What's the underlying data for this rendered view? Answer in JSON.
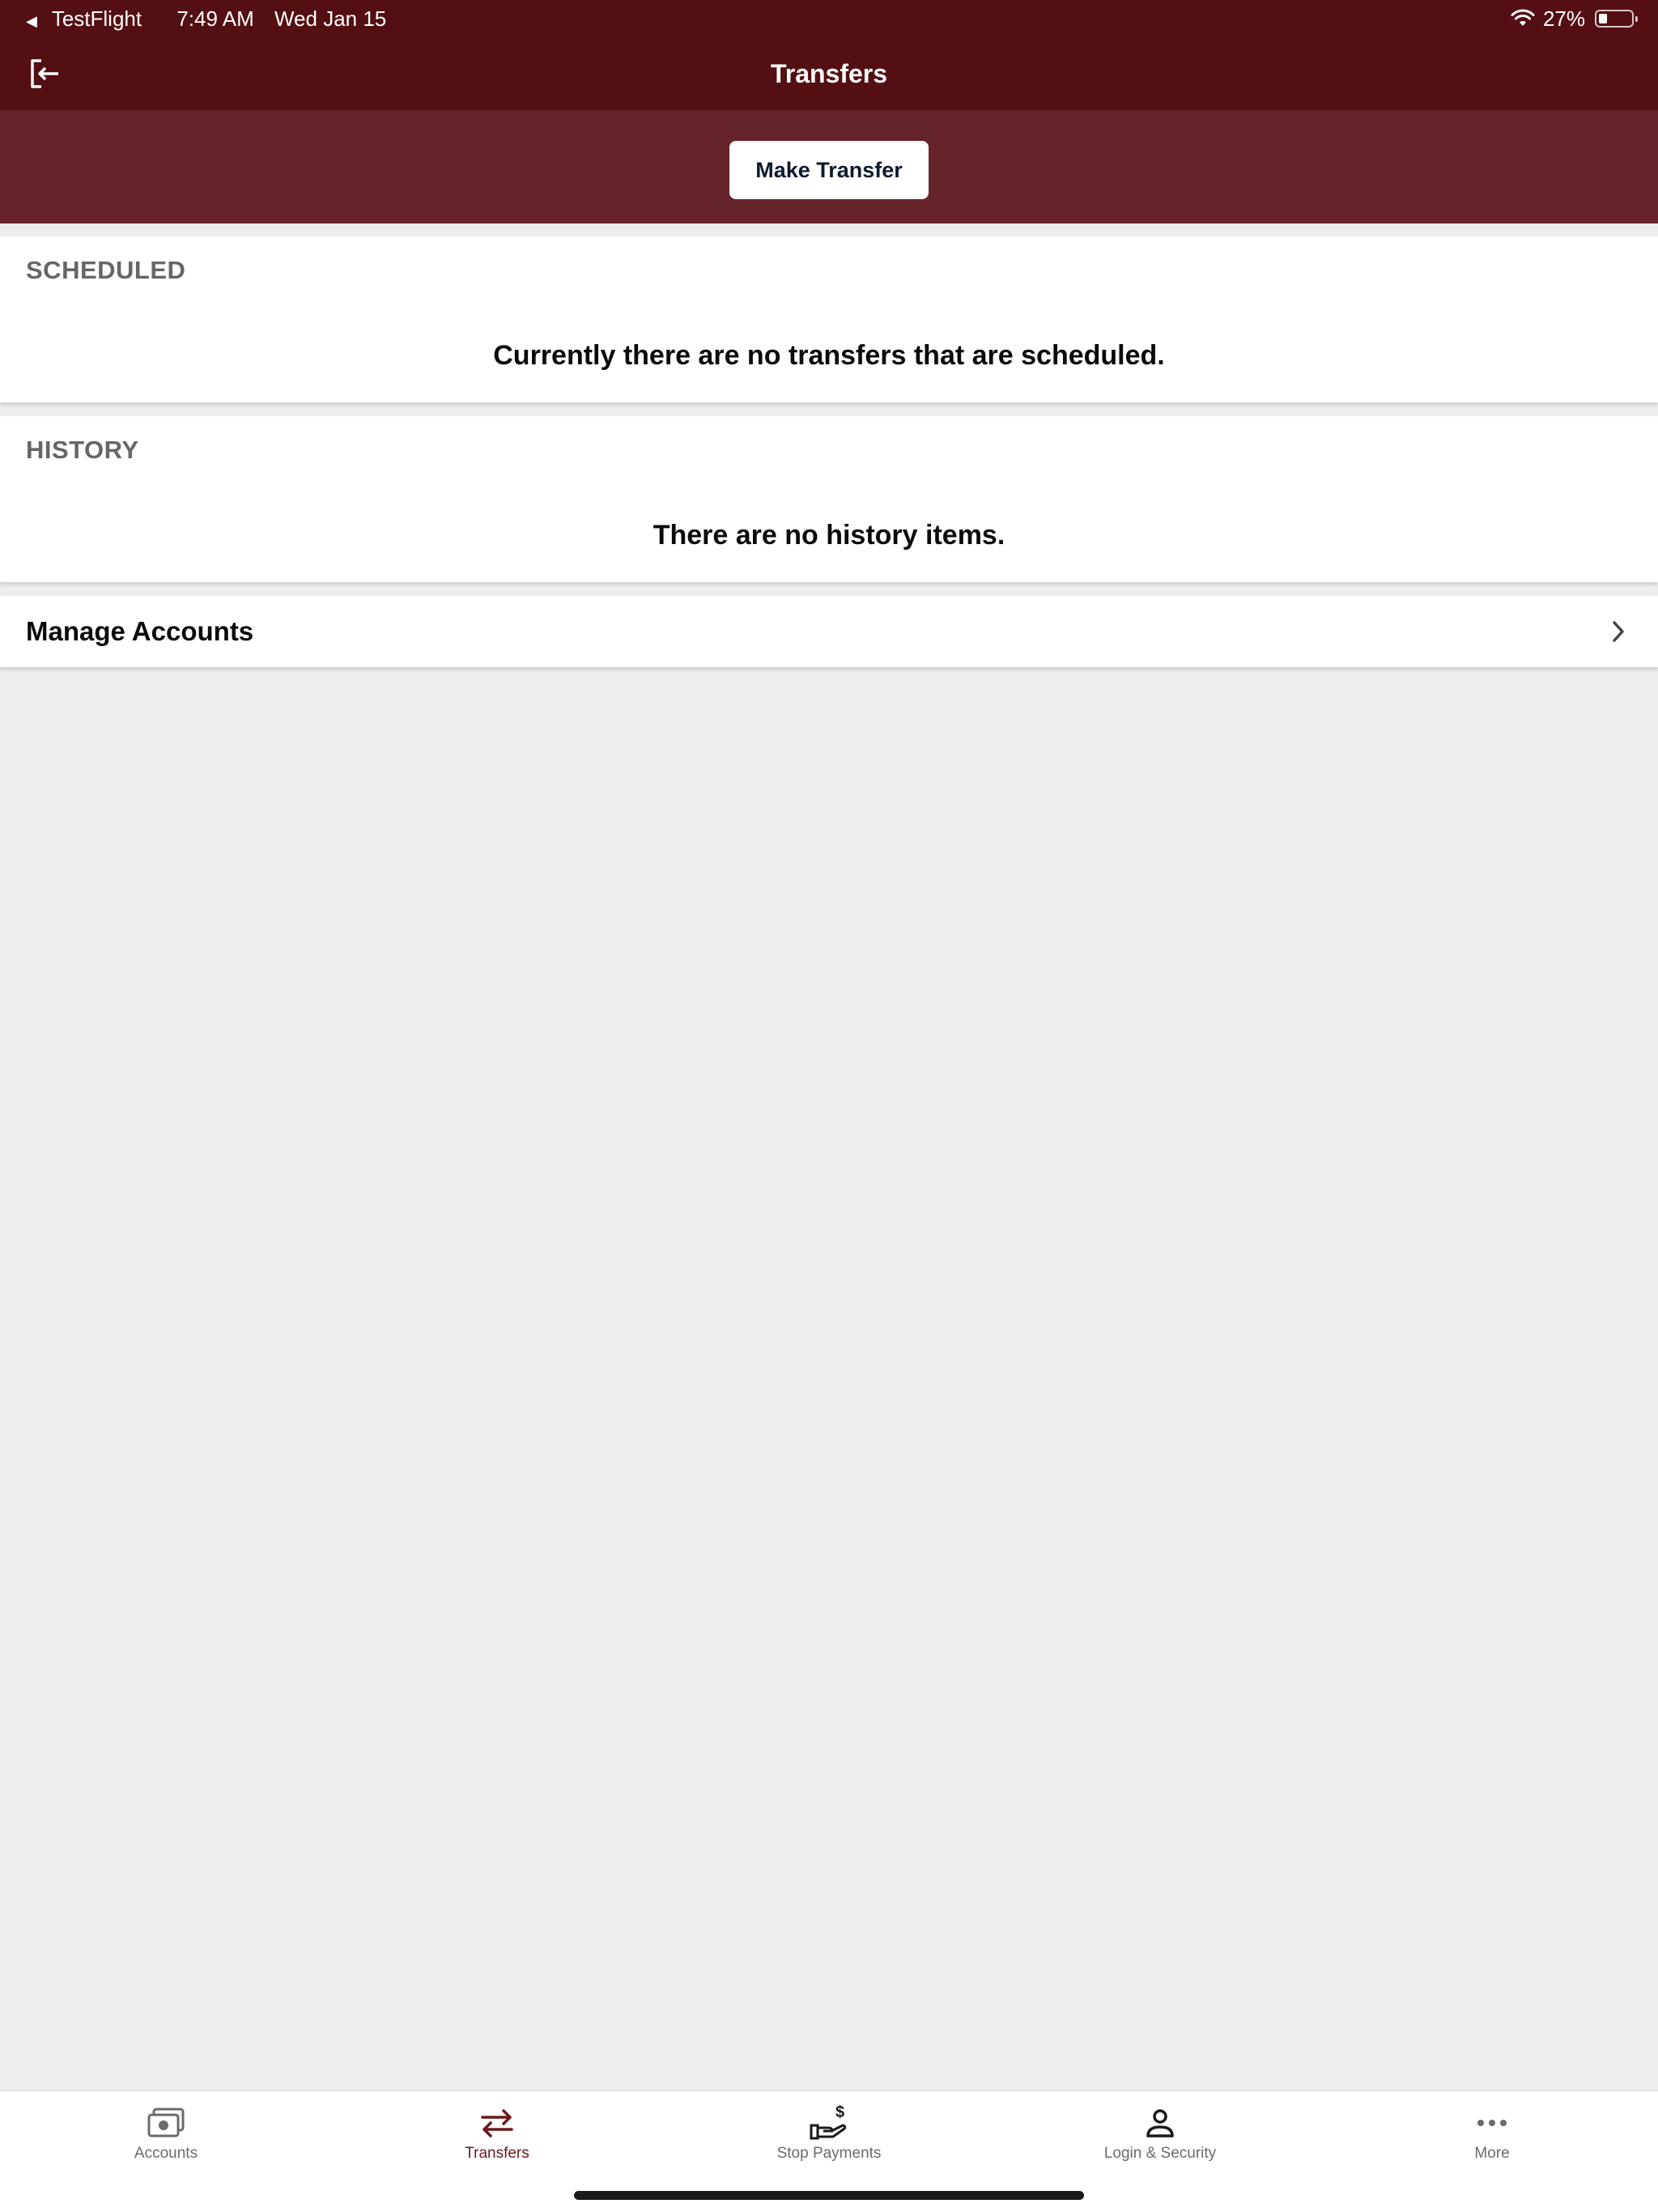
{
  "status_bar": {
    "back_app": "TestFlight",
    "time": "7:49 AM",
    "date": "Wed Jan 15",
    "battery": "27%",
    "battery_level": 0.27
  },
  "nav": {
    "title": "Transfers",
    "logout_icon": "logout-icon"
  },
  "actions": {
    "make_transfer_label": "Make Transfer"
  },
  "scheduled": {
    "header": "SCHEDULED",
    "empty_message": "Currently there are no transfers that are scheduled."
  },
  "history": {
    "header": "HISTORY",
    "empty_message": "There are no history items."
  },
  "manage_accounts": {
    "label": "Manage Accounts"
  },
  "tabs": [
    {
      "label": "Accounts",
      "icon": "money-icon",
      "active": false
    },
    {
      "label": "Transfers",
      "icon": "transfer-arrows-icon",
      "active": true
    },
    {
      "label": "Stop Payments",
      "icon": "hand-dollar-icon",
      "active": false
    },
    {
      "label": "Login & Security",
      "icon": "person-icon",
      "active": false
    },
    {
      "label": "More",
      "icon": "more-dots-icon",
      "active": false
    }
  ],
  "colors": {
    "nav_background": "#540f13",
    "action_band": "#65242a",
    "active_tab": "#6a1a1f",
    "page_background": "#ededed"
  }
}
